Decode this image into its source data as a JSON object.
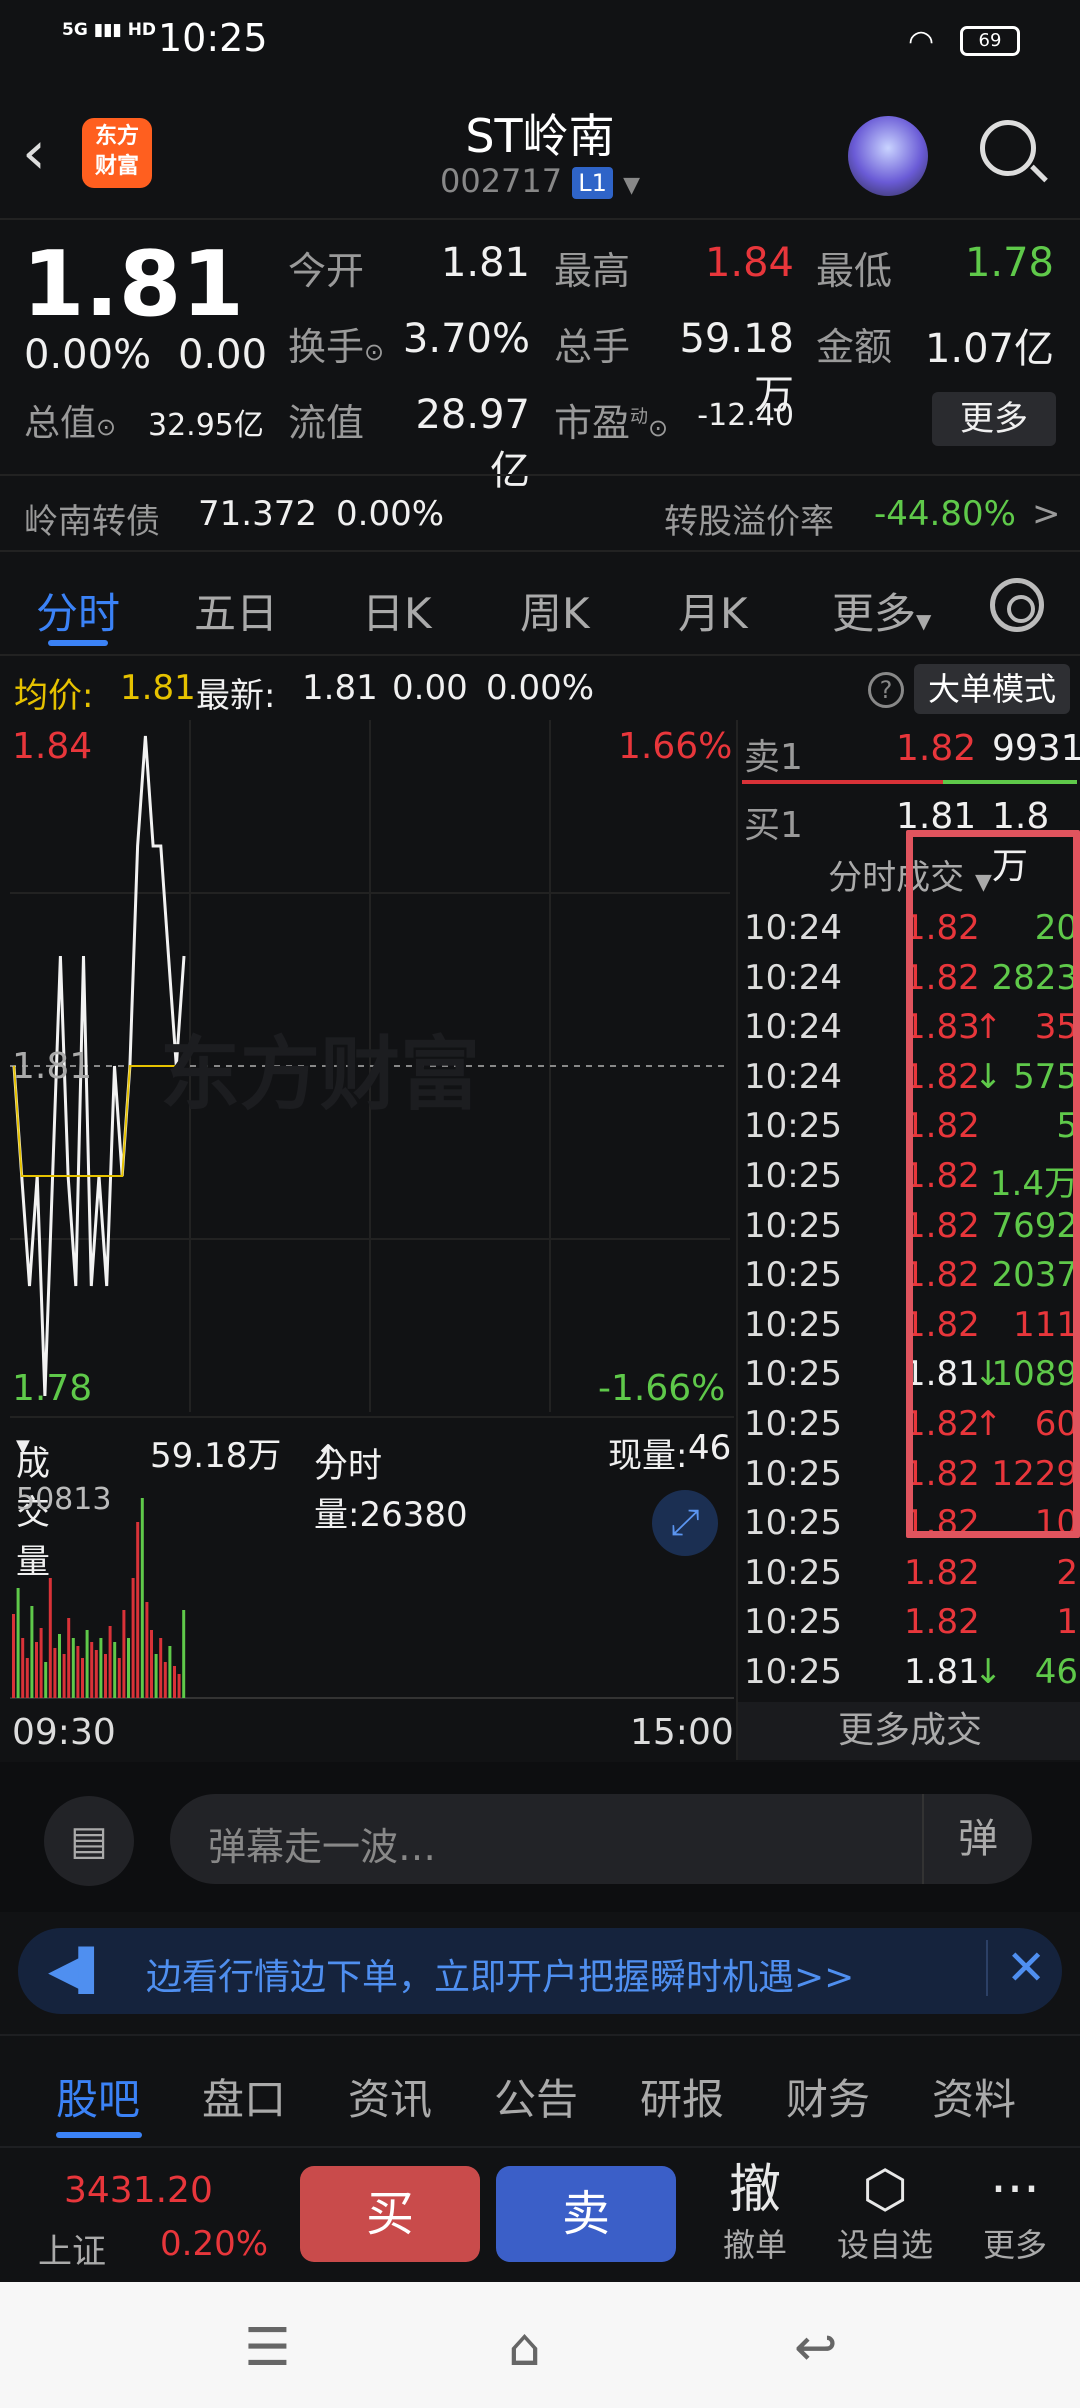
{
  "status_bar": {
    "network": "5G",
    "hd": "HD",
    "time": "10:25",
    "battery": "69"
  },
  "header": {
    "back_icon": "‹",
    "logo_text": "东方财富",
    "name": "ST岭南",
    "code": "002717",
    "level": "L1"
  },
  "quote": {
    "price": "1.81",
    "change_pct": "0.00%",
    "change": "0.00",
    "total_value_label": "总值",
    "total_value": "32.95亿",
    "open_label": "今开",
    "open": "1.81",
    "high_label": "最高",
    "high": "1.84",
    "low_label": "最低",
    "low": "1.78",
    "turnover_label": "换手",
    "turnover": "3.70%",
    "volume_label": "总手",
    "volume": "59.18万",
    "amount_label": "金额",
    "amount": "1.07亿",
    "float_label": "流值",
    "float_value": "28.97亿",
    "pe_label": "市盈",
    "pe_sup": "动",
    "pe": "-12.40",
    "more": "更多"
  },
  "bond": {
    "name": "岭南转债",
    "price": "71.372",
    "pct": "0.00%",
    "premium_label": "转股溢价率",
    "premium": "-44.80%",
    "arrow": ">"
  },
  "tabs": [
    "分时",
    "五日",
    "日K",
    "周K",
    "月K",
    "更多"
  ],
  "avg": {
    "avg_label": "均价:",
    "avg": "1.81",
    "latest_label": "最新:",
    "latest": "1.81",
    "chg": "0.00",
    "pct": "0.00%",
    "help": "?",
    "big_order": "大单模式"
  },
  "chart_data": {
    "type": "line",
    "y_top": "1.84",
    "y_mid": "1.81",
    "y_bottom": "1.78",
    "pct_top": "1.66%",
    "pct_bottom": "-1.66%",
    "watermark": "东方财富",
    "ylim": [
      1.78,
      1.84
    ],
    "series": [
      {
        "values": [
          1.81,
          1.8,
          1.79,
          1.8,
          1.78,
          1.8,
          1.82,
          1.8,
          1.79,
          1.82,
          1.79,
          1.8,
          1.79,
          1.81,
          1.8,
          1.81,
          1.83,
          1.84,
          1.83,
          1.83,
          1.82,
          1.81,
          1.82
        ]
      },
      {
        "values": [
          1.81,
          1.8,
          1.8,
          1.8,
          1.8,
          1.8,
          1.8,
          1.8,
          1.8,
          1.8,
          1.8,
          1.8,
          1.8,
          1.8,
          1.8,
          1.81,
          1.81,
          1.81,
          1.81,
          1.81,
          1.81,
          1.81,
          1.81
        ]
      }
    ]
  },
  "volume": {
    "label": "成交量",
    "total": "59.18万",
    "minute_vol": "分时量:26380",
    "arrow": "↑",
    "current_label": "现量:",
    "current": "46",
    "max": "50813",
    "start": "09:30",
    "end": "15:00",
    "bars": [
      0.42,
      0.55,
      0.3,
      0.2,
      0.46,
      0.28,
      0.35,
      0.18,
      0.6,
      0.25,
      0.32,
      0.22,
      0.4,
      0.3,
      0.26,
      0.2,
      0.34,
      0.28,
      0.24,
      0.3,
      0.22,
      0.36,
      0.28,
      0.2,
      0.44,
      0.3,
      0.6,
      0.88,
      1.0,
      0.48,
      0.34,
      0.22,
      0.3,
      0.18,
      0.26,
      0.16,
      0.12,
      0.44
    ]
  },
  "book": {
    "sell_label": "卖1",
    "sell_price": "1.82",
    "sell_vol": "9931",
    "buy_label": "买1",
    "buy_price": "1.81",
    "buy_vol": "1.8万",
    "ticks_label": "分时成交",
    "ticks": [
      {
        "t": "10:24",
        "p": "1.82",
        "a": "",
        "v": "20",
        "pc": "red",
        "vc": "green"
      },
      {
        "t": "10:24",
        "p": "1.82",
        "a": "",
        "v": "2823",
        "pc": "red",
        "vc": "green"
      },
      {
        "t": "10:24",
        "p": "1.83",
        "a": "↑",
        "v": "35",
        "pc": "red",
        "vc": "red"
      },
      {
        "t": "10:24",
        "p": "1.82",
        "a": "↓",
        "v": "575",
        "pc": "red",
        "vc": "green"
      },
      {
        "t": "10:25",
        "p": "1.82",
        "a": "",
        "v": "5",
        "pc": "red",
        "vc": "green"
      },
      {
        "t": "10:25",
        "p": "1.82",
        "a": "",
        "v": "1.4万",
        "pc": "red",
        "vc": "green"
      },
      {
        "t": "10:25",
        "p": "1.82",
        "a": "",
        "v": "7692",
        "pc": "red",
        "vc": "green"
      },
      {
        "t": "10:25",
        "p": "1.82",
        "a": "",
        "v": "2037",
        "pc": "red",
        "vc": "green"
      },
      {
        "t": "10:25",
        "p": "1.82",
        "a": "",
        "v": "111",
        "pc": "red",
        "vc": "red"
      },
      {
        "t": "10:25",
        "p": "1.81",
        "a": "↓",
        "v": "1089",
        "pc": "white",
        "vc": "green"
      },
      {
        "t": "10:25",
        "p": "1.82",
        "a": "↑",
        "v": "60",
        "pc": "red",
        "vc": "red"
      },
      {
        "t": "10:25",
        "p": "1.82",
        "a": "",
        "v": "1229",
        "pc": "red",
        "vc": "red"
      },
      {
        "t": "10:25",
        "p": "1.82",
        "a": "",
        "v": "10",
        "pc": "red",
        "vc": "red"
      },
      {
        "t": "10:25",
        "p": "1.82",
        "a": "",
        "v": "2",
        "pc": "red",
        "vc": "red"
      },
      {
        "t": "10:25",
        "p": "1.82",
        "a": "",
        "v": "1",
        "pc": "red",
        "vc": "red"
      },
      {
        "t": "10:25",
        "p": "1.81",
        "a": "↓",
        "v": "46",
        "pc": "white",
        "vc": "green"
      }
    ],
    "more": "更多成交"
  },
  "comment": {
    "placeholder": "弹幕走一波…",
    "danmu": "弹"
  },
  "ad": {
    "text": "边看行情边下单，立即开户把握瞬时机遇>>",
    "close": "✕"
  },
  "bottom_tabs": [
    "股吧",
    "盘口",
    "资讯",
    "公告",
    "研报",
    "财务",
    "资料"
  ],
  "trade": {
    "index_value": "3431.20",
    "index_name": "上证",
    "index_pct": "0.20%",
    "buy": "买",
    "sell": "卖",
    "cancel": "撤单",
    "cancel_icon": "撤",
    "watch": "设自选",
    "more": "更多"
  },
  "nav": {
    "menu": "☰",
    "home": "⌂",
    "back": "↩"
  },
  "colors": {
    "up": "#e8363b",
    "down": "#5fc94a",
    "accent": "#3b82f6",
    "highlight": "#e0545e"
  }
}
